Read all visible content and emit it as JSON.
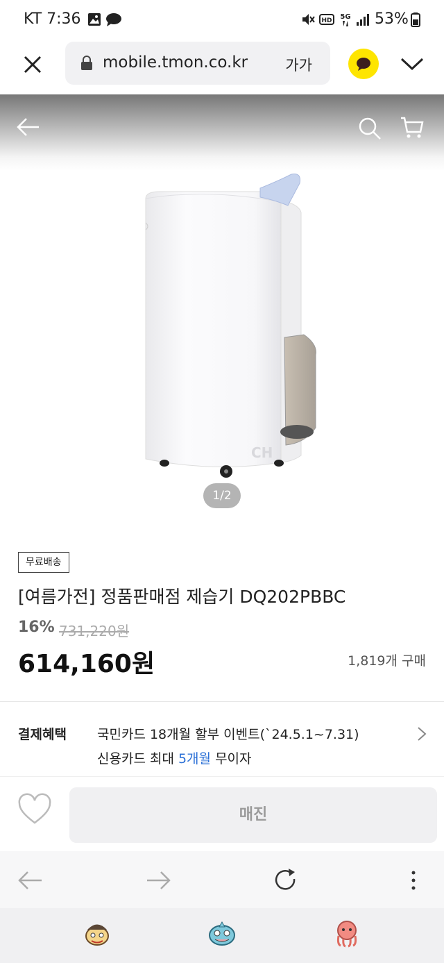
{
  "status_bar": {
    "carrier_time": "KT 7:36",
    "battery": "53%",
    "icons": [
      "gallery-icon",
      "chat-bubble-icon",
      "mute-icon",
      "hd-icon",
      "5g-icon",
      "signal-icon",
      "battery-icon"
    ]
  },
  "browser": {
    "url": "mobile.tmon.co.kr",
    "text_size_label": "가가",
    "accent_color": "#fee500"
  },
  "hero": {
    "pager": "1/2",
    "watermark": "CH"
  },
  "product": {
    "badge": "무료배송",
    "title": "[여름가전] 정품판매점 제습기 DQ202PBBC",
    "discount": "16%",
    "original_price": "731,220원",
    "price": "614,160원",
    "sold_count": "1,819개 구매"
  },
  "benefits": {
    "heading": "결제혜택",
    "line1": "국민카드 18개월 할부 이벤트(`24.5.1~7.31)",
    "line2_prefix": "신용카드 최대 ",
    "line2_highlight": "5개월",
    "line2_suffix": " 무이자",
    "highlight_color": "#2a6fd6"
  },
  "buy_bar": {
    "soldout_label": "매진"
  }
}
